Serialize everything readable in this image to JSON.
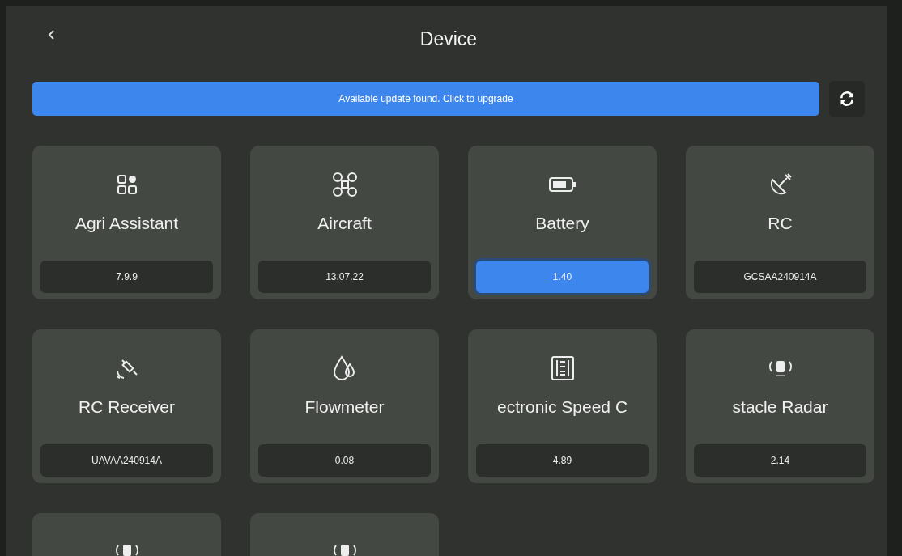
{
  "header": {
    "title": "Device"
  },
  "update_banner": {
    "text": "Available update found. Click to upgrade"
  },
  "devices": [
    {
      "kind": "assistant",
      "name": "Agri Assistant",
      "version": "7.9.9",
      "selected": false
    },
    {
      "kind": "drone",
      "name": "Aircraft",
      "version": "13.07.22",
      "selected": false
    },
    {
      "kind": "battery",
      "name": "Battery",
      "version": "1.40",
      "selected": true
    },
    {
      "kind": "dish",
      "name": "RC",
      "version": "GCSAA240914A",
      "selected": false
    },
    {
      "kind": "satellite",
      "name": "RC Receiver",
      "version": "UAVAA240914A",
      "selected": false
    },
    {
      "kind": "drops",
      "name": "Flowmeter",
      "version": "0.08",
      "selected": false
    },
    {
      "kind": "esc",
      "name": "ectronic Speed C",
      "version": "4.89",
      "selected": false
    },
    {
      "kind": "radar",
      "name": "stacle Radar",
      "version": "2.14",
      "selected": false
    },
    {
      "kind": "radar"
    },
    {
      "kind": "radar"
    }
  ]
}
